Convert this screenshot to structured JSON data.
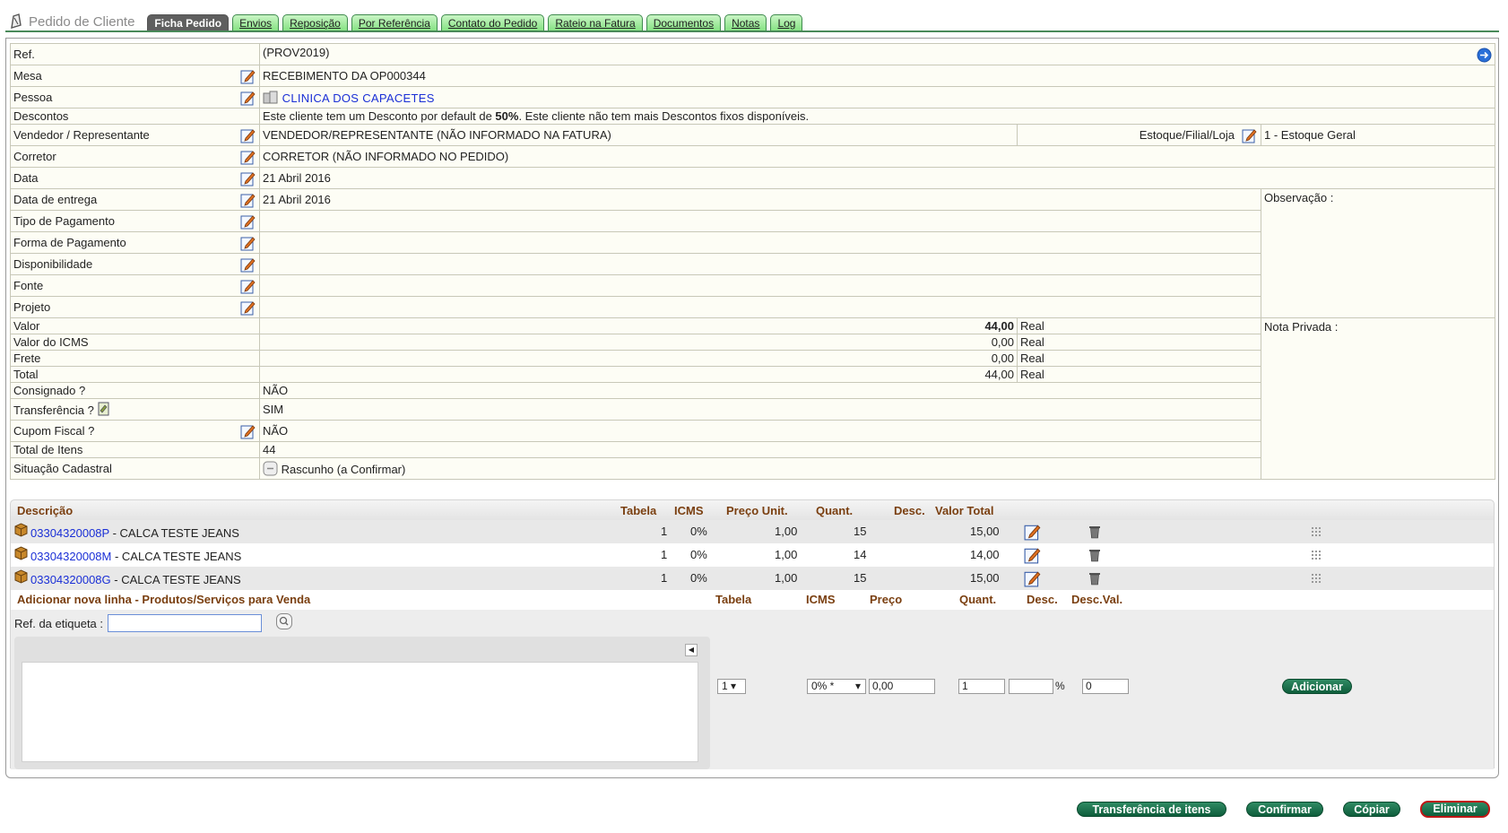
{
  "app": {
    "title": "Pedido de Cliente"
  },
  "tabs": [
    "Ficha Pedido",
    "Envios",
    "Reposição",
    "Por Referência",
    "Contato do Pedido",
    "Rateio na Fatura",
    "Documentos",
    "Notas",
    "Log"
  ],
  "fields": {
    "ref_label": "Ref.",
    "ref_value": "(PROV2019)",
    "mesa_label": "Mesa",
    "mesa_value": "RECEBIMENTO DA OP000344",
    "pessoa_label": "Pessoa",
    "pessoa_value": "CLINICA DOS CAPACETES",
    "descontos_label": "Descontos",
    "descontos_pre": "Este cliente tem um Desconto por default de ",
    "descontos_pct": "50%",
    "descontos_post": ". Este cliente não tem mais Descontos fixos disponíveis.",
    "vendedor_label": "Vendedor / Representante",
    "vendedor_value": "VENDEDOR/REPRESENTANTE (NÃO INFORMADO NA FATURA)",
    "estoque_label": "Estoque/Filial/Loja",
    "estoque_value": "1 - Estoque Geral",
    "corretor_label": "Corretor",
    "corretor_value": "CORRETOR (NÃO INFORMADO NO PEDIDO)",
    "data_label": "Data",
    "data_value": "21 Abril 2016",
    "entrega_label": "Data de entrega",
    "entrega_value": "21 Abril 2016",
    "observacao_label": "Observação :",
    "tipo_pag_label": "Tipo de Pagamento",
    "forma_pag_label": "Forma de Pagamento",
    "disponibilidade_label": "Disponibilidade",
    "fonte_label": "Fonte",
    "projeto_label": "Projeto",
    "valor_label": "Valor",
    "valor_value": "44,00",
    "valor_curr": "Real",
    "nota_privada_label": "Nota Privada :",
    "icms_label": "Valor do ICMS",
    "icms_value": "0,00",
    "icms_curr": "Real",
    "frete_label": "Frete",
    "frete_value": "0,00",
    "frete_curr": "Real",
    "total_label": "Total",
    "total_value": "44,00",
    "total_curr": "Real",
    "consignado_label": "Consignado ?",
    "consignado_value": "NÃO",
    "transferencia_label": "Transferência ?",
    "transferencia_value": "SIM",
    "cupom_label": "Cupom Fiscal ?",
    "cupom_value": "NÃO",
    "total_itens_label": "Total de Itens",
    "total_itens_value": "44",
    "situacao_label": "Situação Cadastral",
    "situacao_value": "Rascunho (a Confirmar)"
  },
  "lines": {
    "headers": {
      "descricao": "Descrição",
      "tabela": "Tabela",
      "icms": "ICMS",
      "preco": "Preço Unit.",
      "quant": "Quant.",
      "desc": "Desc.",
      "valor": "Valor Total"
    },
    "rows": [
      {
        "ref": "03304320008P",
        "label": " - CALCA TESTE JEANS",
        "tabela": "1",
        "icms": "0%",
        "preco": "1,00",
        "quant": "15",
        "valor": "15,00"
      },
      {
        "ref": "03304320008M",
        "label": " - CALCA TESTE JEANS",
        "tabela": "1",
        "icms": "0%",
        "preco": "1,00",
        "quant": "14",
        "valor": "14,00"
      },
      {
        "ref": "03304320008G",
        "label": " - CALCA TESTE JEANS",
        "tabela": "1",
        "icms": "0%",
        "preco": "1,00",
        "quant": "15",
        "valor": "15,00"
      }
    ]
  },
  "add": {
    "title": "Adicionar nova linha - Produtos/Serviços para Venda",
    "h_tabela": "Tabela",
    "h_icms": "ICMS",
    "h_preco": "Preço",
    "h_quant": "Quant.",
    "h_desc": "Desc.",
    "h_descval": "Desc.Val.",
    "ref_label": "Ref. da etiqueta :",
    "tabela_value": "1",
    "icms_value": "0% *",
    "preco_value": "0,00",
    "quant_value": "1",
    "desc_value": "",
    "pct": "%",
    "descval_value": "0",
    "add_button": "Adicionar"
  },
  "actions": {
    "transfer": "Transferência de itens",
    "confirm": "Confirmar",
    "copy": "Cópiar",
    "delete": "Eliminar"
  },
  "colors": {
    "tab_green": "#7fe07c",
    "button_green": "#0f5e3c",
    "link_blue": "#1a2fd6",
    "header_brown": "#7a3f10",
    "delete_border": "#c01515"
  }
}
